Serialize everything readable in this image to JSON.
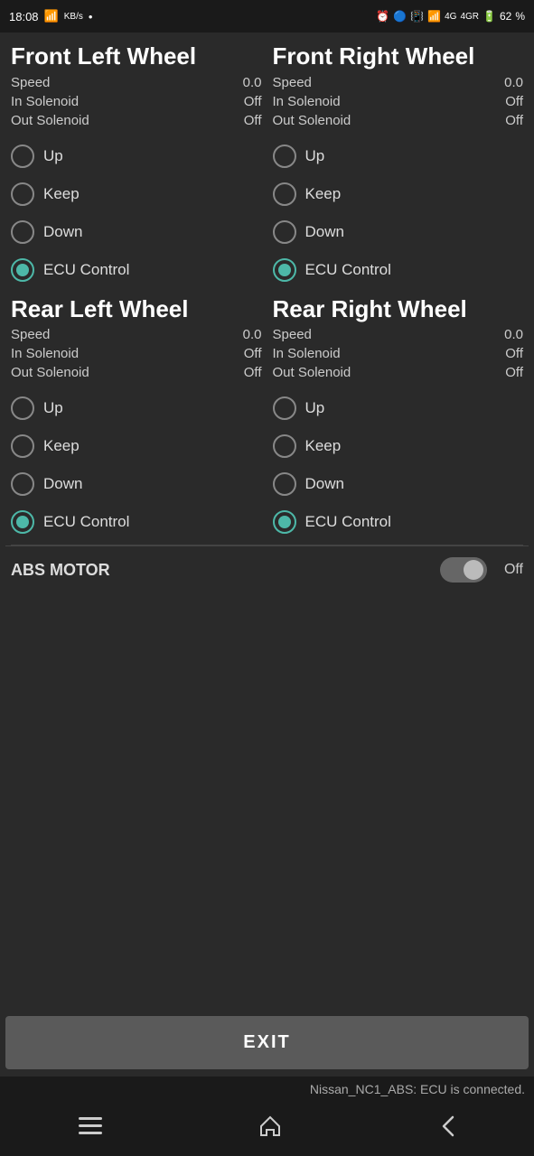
{
  "statusBar": {
    "time": "18:08",
    "batteryPercent": "62"
  },
  "frontLeftWheel": {
    "title": "Front Left Wheel",
    "speed": {
      "label": "Speed",
      "value": "0.0"
    },
    "inSolenoid": {
      "label": "In Solenoid",
      "value": "Off"
    },
    "outSolenoid": {
      "label": "Out Solenoid",
      "value": "Off"
    },
    "options": [
      "Up",
      "Keep",
      "Down",
      "ECU Control"
    ],
    "selected": "ECU Control"
  },
  "frontRightWheel": {
    "title": "Front Right Wheel",
    "speed": {
      "label": "Speed",
      "value": "0.0"
    },
    "inSolenoid": {
      "label": "In Solenoid",
      "value": "Off"
    },
    "outSolenoid": {
      "label": "Out Solenoid",
      "value": "Off"
    },
    "options": [
      "Up",
      "Keep",
      "Down",
      "ECU Control"
    ],
    "selected": "ECU Control"
  },
  "rearLeftWheel": {
    "title": "Rear Left Wheel",
    "speed": {
      "label": "Speed",
      "value": "0.0"
    },
    "inSolenoid": {
      "label": "In Solenoid",
      "value": "Off"
    },
    "outSolenoid": {
      "label": "Out Solenoid",
      "value": "Off"
    },
    "options": [
      "Up",
      "Keep",
      "Down",
      "ECU Control"
    ],
    "selected": "ECU Control"
  },
  "rearRightWheel": {
    "title": "Rear Right Wheel",
    "speed": {
      "label": "Speed",
      "value": "0.0"
    },
    "inSolenoid": {
      "label": "In Solenoid",
      "value": "Off"
    },
    "outSolenoid": {
      "label": "Out Solenoid",
      "value": "Off"
    },
    "options": [
      "Up",
      "Keep",
      "Down",
      "ECU Control"
    ],
    "selected": "ECU Control"
  },
  "absMotor": {
    "label": "ABS MOTOR",
    "value": "Off",
    "enabled": false
  },
  "exitButton": {
    "label": "EXIT"
  },
  "statusMessage": "Nissan_NC1_ABS: ECU is connected.",
  "nav": {
    "menu": "☰",
    "home": "⌂",
    "back": "<"
  }
}
